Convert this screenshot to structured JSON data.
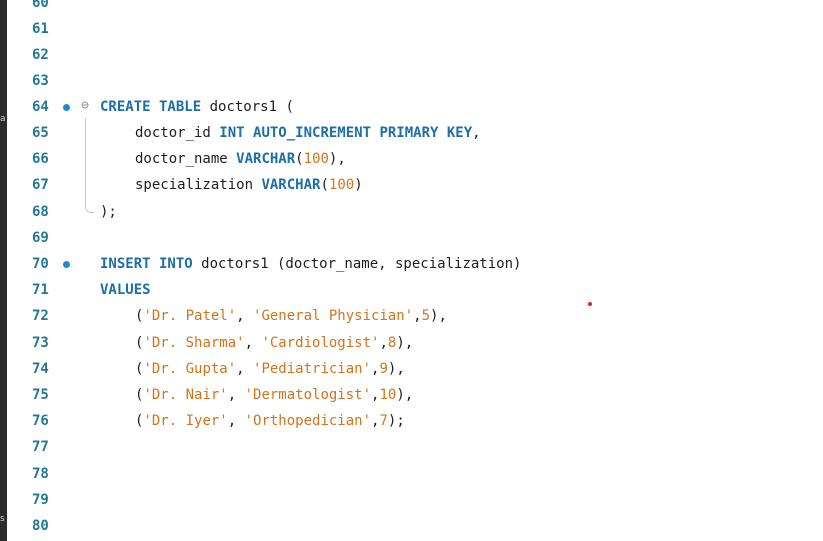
{
  "left_strip": {
    "glyph_top": "a",
    "glyph_bottom": "s"
  },
  "editor": {
    "lines": [
      {
        "number": "60",
        "text": ""
      },
      {
        "number": "61",
        "text": ""
      },
      {
        "number": "62",
        "text": ""
      },
      {
        "number": "63",
        "text": ""
      },
      {
        "number": "64",
        "breakpoint": true,
        "fold": true
      },
      {
        "number": "65"
      },
      {
        "number": "66"
      },
      {
        "number": "67"
      },
      {
        "number": "68"
      },
      {
        "number": "69"
      },
      {
        "number": "70",
        "breakpoint": true
      },
      {
        "number": "71"
      },
      {
        "number": "72"
      },
      {
        "number": "73"
      },
      {
        "number": "74"
      },
      {
        "number": "75"
      },
      {
        "number": "76"
      },
      {
        "number": "77"
      },
      {
        "number": "78"
      },
      {
        "number": "79"
      },
      {
        "number": "80"
      }
    ],
    "tokens": {
      "l64": {
        "kw1": "CREATE TABLE",
        "ident": " doctors1 ("
      },
      "l65": {
        "ident": "doctor_id ",
        "kw1": "INT AUTO_INCREMENT PRIMARY KEY",
        "punc": ","
      },
      "l66": {
        "ident": "doctor_name ",
        "kw1": "VARCHAR",
        "p1": "(",
        "num": "100",
        "p2": "),"
      },
      "l67": {
        "ident": "specialization ",
        "kw1": "VARCHAR",
        "p1": "(",
        "num": "100",
        "p2": ")"
      },
      "l68": {
        "punc": ");"
      },
      "l70": {
        "kw1": "INSERT INTO",
        "ident": " doctors1 (doctor_name, specialization)"
      },
      "l71": {
        "kw1": "VALUES"
      },
      "l72": {
        "p1": "(",
        "s1": "'Dr. Patel'",
        "p2": ", ",
        "s2": "'General Physician'",
        "p3": ",",
        "num": "5",
        "p4": "),"
      },
      "l73": {
        "p1": "(",
        "s1": "'Dr. Sharma'",
        "p2": ", ",
        "s2": "'Cardiologist'",
        "p3": ",",
        "num": "8",
        "p4": "),"
      },
      "l74": {
        "p1": "(",
        "s1": "'Dr. Gupta'",
        "p2": ", ",
        "s2": "'Pediatrician'",
        "p3": ",",
        "num": "9",
        "p4": "),"
      },
      "l75": {
        "p1": "(",
        "s1": "'Dr. Nair'",
        "p2": ", ",
        "s2": "'Dermatologist'",
        "p3": ",",
        "num": "10",
        "p4": "),"
      },
      "l76": {
        "p1": "(",
        "s1": "'Dr. Iyer'",
        "p2": ", ",
        "s2": "'Orthopedician'",
        "p3": ",",
        "num": "7",
        "p4": ");"
      }
    }
  },
  "colors": {
    "keyword": "#1e6ea8",
    "string": "#d3731c",
    "number": "#d3731c",
    "line_number": "#237893",
    "breakpoint": "#1f8ad2",
    "marker": "#e02020"
  }
}
